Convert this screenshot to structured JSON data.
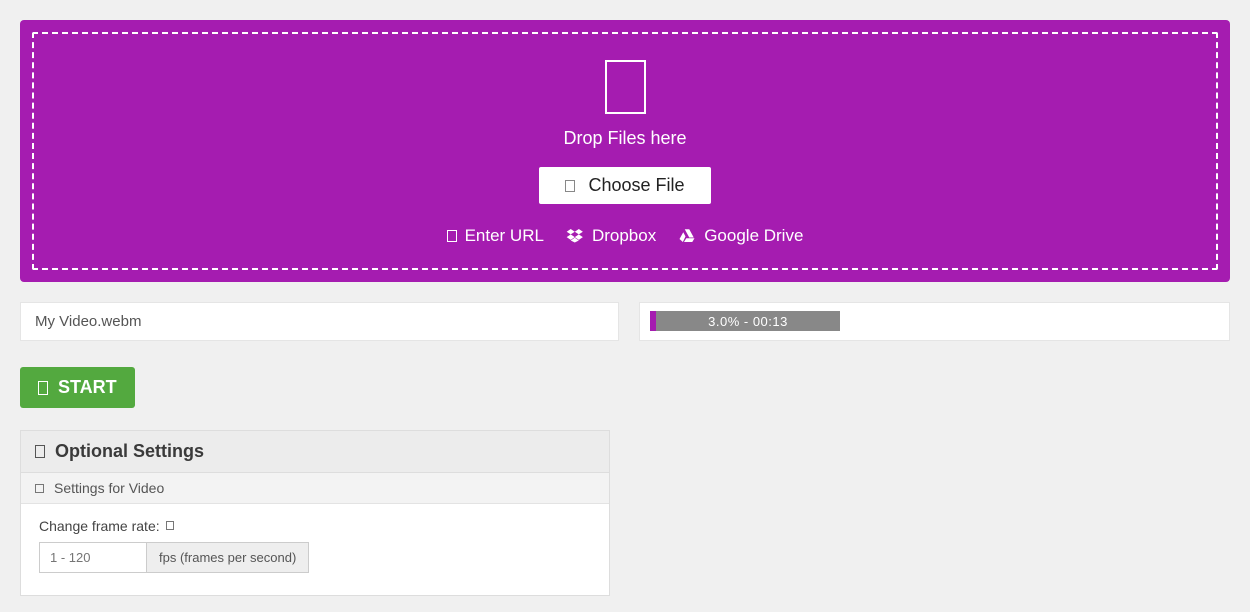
{
  "dropzone": {
    "drop_label": "Drop Files here",
    "choose_label": "Choose File",
    "url_label": "Enter URL",
    "dropbox_label": "Dropbox",
    "gdrive_label": "Google Drive"
  },
  "file": {
    "name": "My Video.webm"
  },
  "progress": {
    "text": "3.0% - 00:13"
  },
  "start_label": "START",
  "settings": {
    "title": "Optional Settings",
    "subtitle": "Settings for Video",
    "frame_rate": {
      "label": "Change frame rate:",
      "placeholder": "1 - 120",
      "suffix": "fps (frames per second)"
    }
  }
}
